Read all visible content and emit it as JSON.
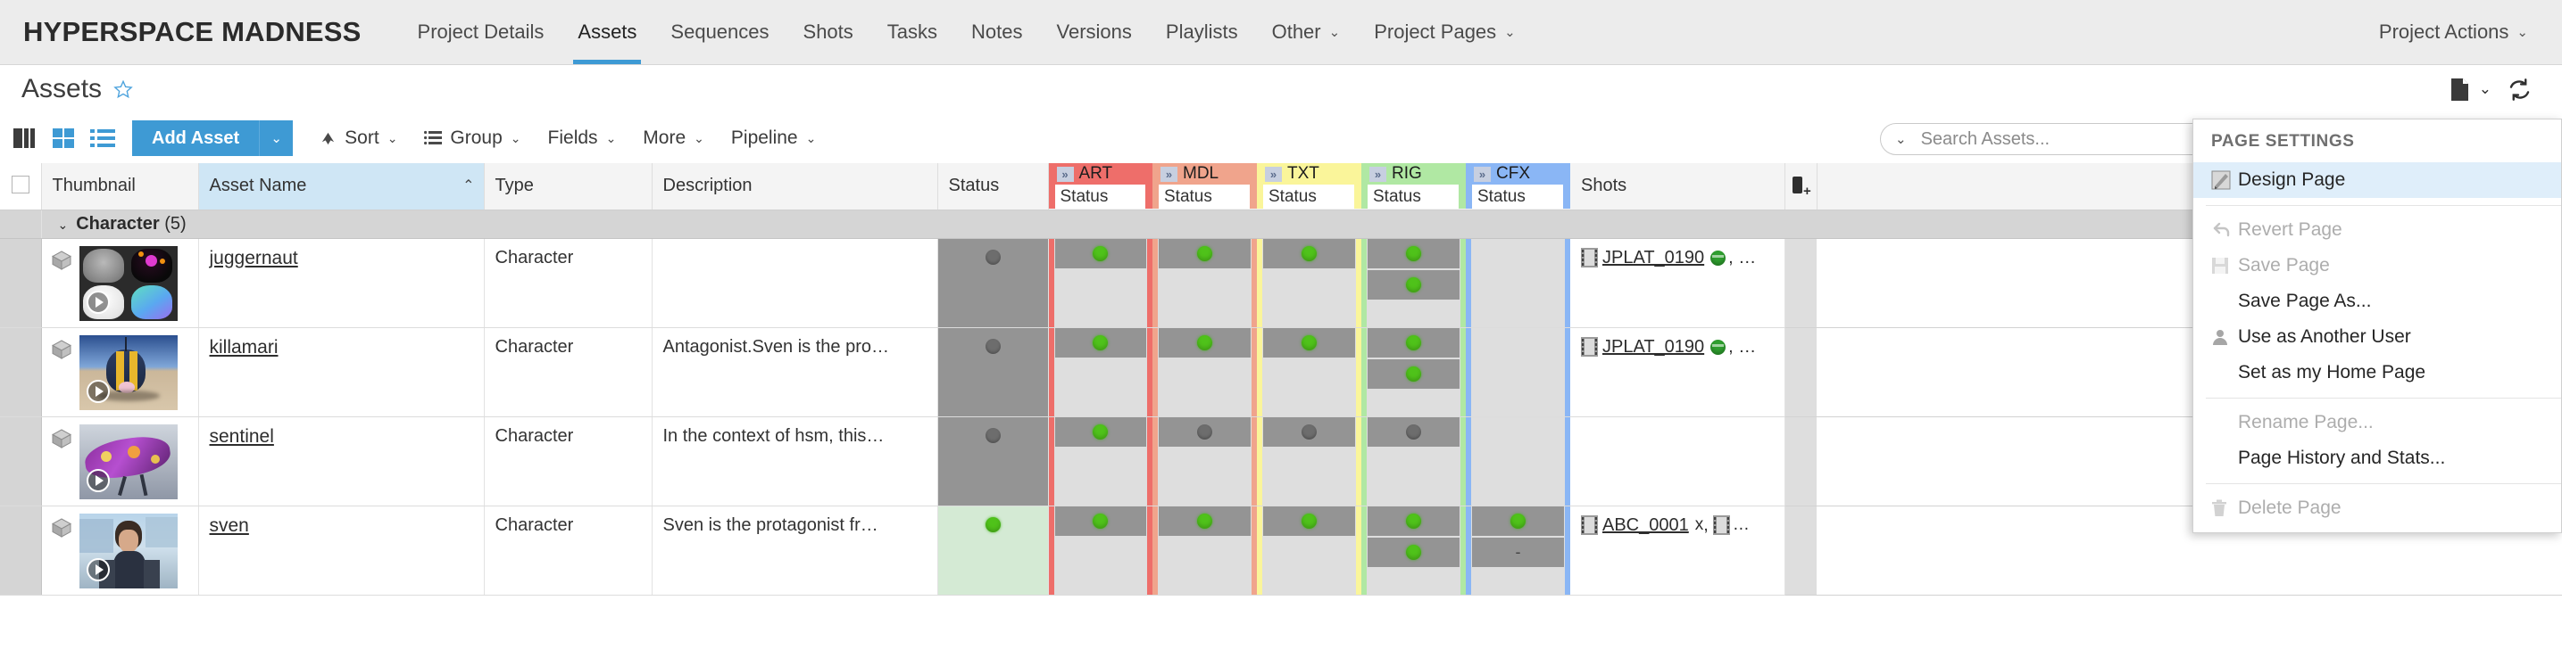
{
  "topnav": {
    "brand": "HYPERSPACE MADNESS",
    "links": [
      {
        "label": "Project Details",
        "active": false,
        "caret": ""
      },
      {
        "label": "Assets",
        "active": true,
        "caret": ""
      },
      {
        "label": "Sequences",
        "active": false,
        "caret": ""
      },
      {
        "label": "Shots",
        "active": false,
        "caret": ""
      },
      {
        "label": "Tasks",
        "active": false,
        "caret": ""
      },
      {
        "label": "Notes",
        "active": false,
        "caret": ""
      },
      {
        "label": "Versions",
        "active": false,
        "caret": ""
      },
      {
        "label": "Playlists",
        "active": false,
        "caret": ""
      },
      {
        "label": "Other",
        "active": false,
        "caret": "⌄"
      },
      {
        "label": "Project Pages",
        "active": false,
        "caret": "⌄"
      }
    ],
    "project_actions": {
      "label": "Project Actions",
      "caret": "⌄"
    }
  },
  "pagehead": {
    "title": "Assets",
    "star_icon": "star-outline-icon",
    "page_icon": "page-icon",
    "page_caret": "⌄",
    "refresh_icon": "refresh-icon"
  },
  "toolbar": {
    "view_modes": [
      "split-view-icon",
      "grid-view-icon",
      "list-view-icon"
    ],
    "add_asset_label": "Add Asset",
    "add_asset_caret": "⌄",
    "items": [
      {
        "label": "Sort",
        "icon": "sort-arrow-icon",
        "caret": "⌄"
      },
      {
        "label": "Group",
        "icon": "group-icon",
        "caret": "⌄"
      },
      {
        "label": "Fields",
        "icon": "",
        "caret": "⌄"
      },
      {
        "label": "More",
        "icon": "",
        "caret": "⌄"
      },
      {
        "label": "Pipeline",
        "icon": "",
        "caret": "⌄"
      }
    ],
    "search": {
      "caret": "⌄",
      "placeholder": "Search Assets...",
      "value": ""
    }
  },
  "table": {
    "columns": [
      {
        "label": "Thumbnail",
        "key": "thumbnail",
        "sorted": false
      },
      {
        "label": "Asset Name",
        "key": "name",
        "sorted": true,
        "sort_arrow": "⌃"
      },
      {
        "label": "Type",
        "key": "type",
        "sorted": false
      },
      {
        "label": "Description",
        "key": "description",
        "sorted": false
      },
      {
        "label": "Status",
        "key": "status",
        "sorted": false
      }
    ],
    "pipeline_columns": [
      {
        "code": "ART",
        "sub": "Status",
        "color": "#ee6e6a",
        "chevron": "»"
      },
      {
        "code": "MDL",
        "sub": "Status",
        "color": "#f0a48c",
        "chevron": "»"
      },
      {
        "code": "TXT",
        "sub": "Status",
        "color": "#faf59a",
        "chevron": "»"
      },
      {
        "code": "RIG",
        "sub": "Status",
        "color": "#b0e8a3",
        "chevron": "»"
      },
      {
        "code": "CFX",
        "sub": "Status",
        "color": "#8ab6f5",
        "chevron": "»"
      }
    ],
    "shots_column": {
      "label": "Shots",
      "add_icon": "add-column-icon"
    },
    "group": {
      "chevron": "⌄",
      "name": "Character",
      "count": "(5)"
    },
    "rows": [
      {
        "name": "juggernaut",
        "type": "Character",
        "description": "",
        "status_dot": "grey",
        "status_bg": "#949494",
        "thumb_style": "juggernaut",
        "pipeline": {
          "ART": [
            "green"
          ],
          "MDL": [
            "green"
          ],
          "TXT": [
            "green"
          ],
          "RIG": [
            "green",
            "green"
          ],
          "CFX": []
        },
        "shots": {
          "code": "JPLAT_0190",
          "bead": true,
          "suffix": ", …",
          "x": false
        }
      },
      {
        "name": "killamari",
        "type": "Character",
        "description": "Antagonist.Sven is the pro…",
        "status_dot": "grey",
        "status_bg": "#949494",
        "thumb_style": "killamari",
        "pipeline": {
          "ART": [
            "green"
          ],
          "MDL": [
            "green"
          ],
          "TXT": [
            "green"
          ],
          "RIG": [
            "green",
            "green"
          ],
          "CFX": []
        },
        "shots": {
          "code": "JPLAT_0190",
          "bead": true,
          "suffix": ", …",
          "x": false
        }
      },
      {
        "name": "sentinel",
        "type": "Character",
        "description": "In the context of hsm, this…",
        "status_dot": "grey",
        "status_bg": "#949494",
        "thumb_style": "sentinel",
        "pipeline": {
          "ART": [
            "green"
          ],
          "MDL": [
            "grey"
          ],
          "TXT": [
            "grey"
          ],
          "RIG": [
            "grey"
          ],
          "CFX": []
        },
        "shots": {
          "code": "",
          "bead": false,
          "suffix": "",
          "x": false
        }
      },
      {
        "name": "sven",
        "type": "Character",
        "description": "Sven is the protagonist fr…",
        "status_dot": "green",
        "status_bg": "#d4ead4",
        "thumb_style": "sven",
        "pipeline": {
          "ART": [
            "green"
          ],
          "MDL": [
            "green"
          ],
          "TXT": [
            "green"
          ],
          "RIG": [
            "green",
            "green"
          ],
          "CFX": [
            "green",
            "dash"
          ]
        },
        "shots": {
          "code": "ABC_0001",
          "bead": false,
          "suffix": ", ",
          "x": true
        }
      }
    ]
  },
  "page_settings_menu": {
    "title": "PAGE SETTINGS",
    "items": [
      {
        "label": "Design Page",
        "icon": "design-pencil-icon",
        "disabled": false,
        "highlighted": true
      },
      {
        "sep": true
      },
      {
        "label": "Revert Page",
        "icon": "revert-arrow-icon",
        "disabled": true,
        "highlighted": false
      },
      {
        "label": "Save Page",
        "icon": "floppy-save-icon",
        "disabled": true,
        "highlighted": false
      },
      {
        "label": "Save Page As...",
        "icon": "",
        "disabled": false,
        "highlighted": false
      },
      {
        "label": "Use as Another User",
        "icon": "user-icon",
        "disabled": false,
        "highlighted": false
      },
      {
        "label": "Set as my Home Page",
        "icon": "",
        "disabled": false,
        "highlighted": false
      },
      {
        "sep": true
      },
      {
        "label": "Rename Page...",
        "icon": "",
        "disabled": true,
        "highlighted": false
      },
      {
        "label": "Page History and Stats...",
        "icon": "",
        "disabled": false,
        "highlighted": false
      },
      {
        "sep": true
      },
      {
        "label": "Delete Page",
        "icon": "trash-icon",
        "disabled": true,
        "highlighted": false
      }
    ]
  },
  "colors": {
    "accent": "#3e9ad4",
    "nav_bg": "#ececec",
    "green_dot": "#4fc21a",
    "grey_dot": "#6d6d6d"
  }
}
